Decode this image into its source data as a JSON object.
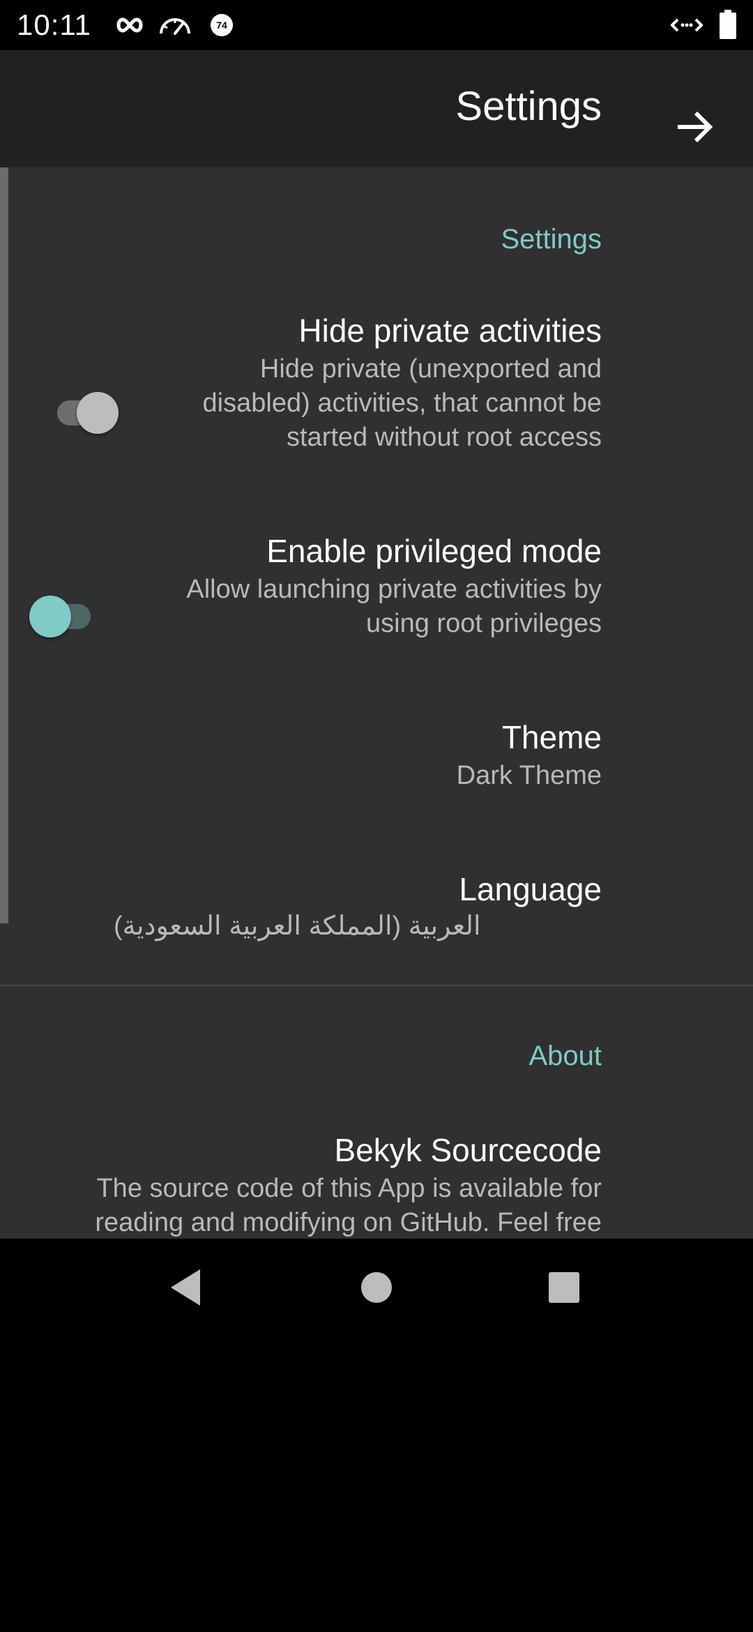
{
  "status_bar": {
    "time": "10:11",
    "icons_left": [
      "infinity-icon",
      "speedometer-icon",
      "badge-74-icon"
    ],
    "badge_text": "74",
    "icons_right": [
      "code-arrows-icon",
      "battery-icon"
    ]
  },
  "app_bar": {
    "title": "Settings",
    "forward_icon": "arrow-right-icon"
  },
  "settings_section": {
    "header": "Settings",
    "hide_private": {
      "title": "Hide private activities",
      "summary": "Hide private (unexported and disabled) activities, that cannot be started without root access",
      "enabled": true
    },
    "privileged_mode": {
      "title": "Enable privileged mode",
      "summary": "Allow launching private activities by using root privileges",
      "enabled": false
    },
    "theme": {
      "title": "Theme",
      "value": "Dark Theme"
    },
    "language": {
      "title": "Language",
      "value": "العربية (المملكة العربية السعودية)"
    }
  },
  "about_section": {
    "header": "About",
    "sourcecode": {
      "title": "Bekyk Sourcecode",
      "summary": "The source code of this App is available for reading and modifying on GitHub. Feel free"
    }
  },
  "nav_bar": {
    "icons": [
      "back-triangle-icon",
      "home-circle-icon",
      "recents-square-icon"
    ]
  },
  "colors": {
    "accent": "#80cbc4",
    "app_bar": "#212121",
    "background": "#303030"
  }
}
